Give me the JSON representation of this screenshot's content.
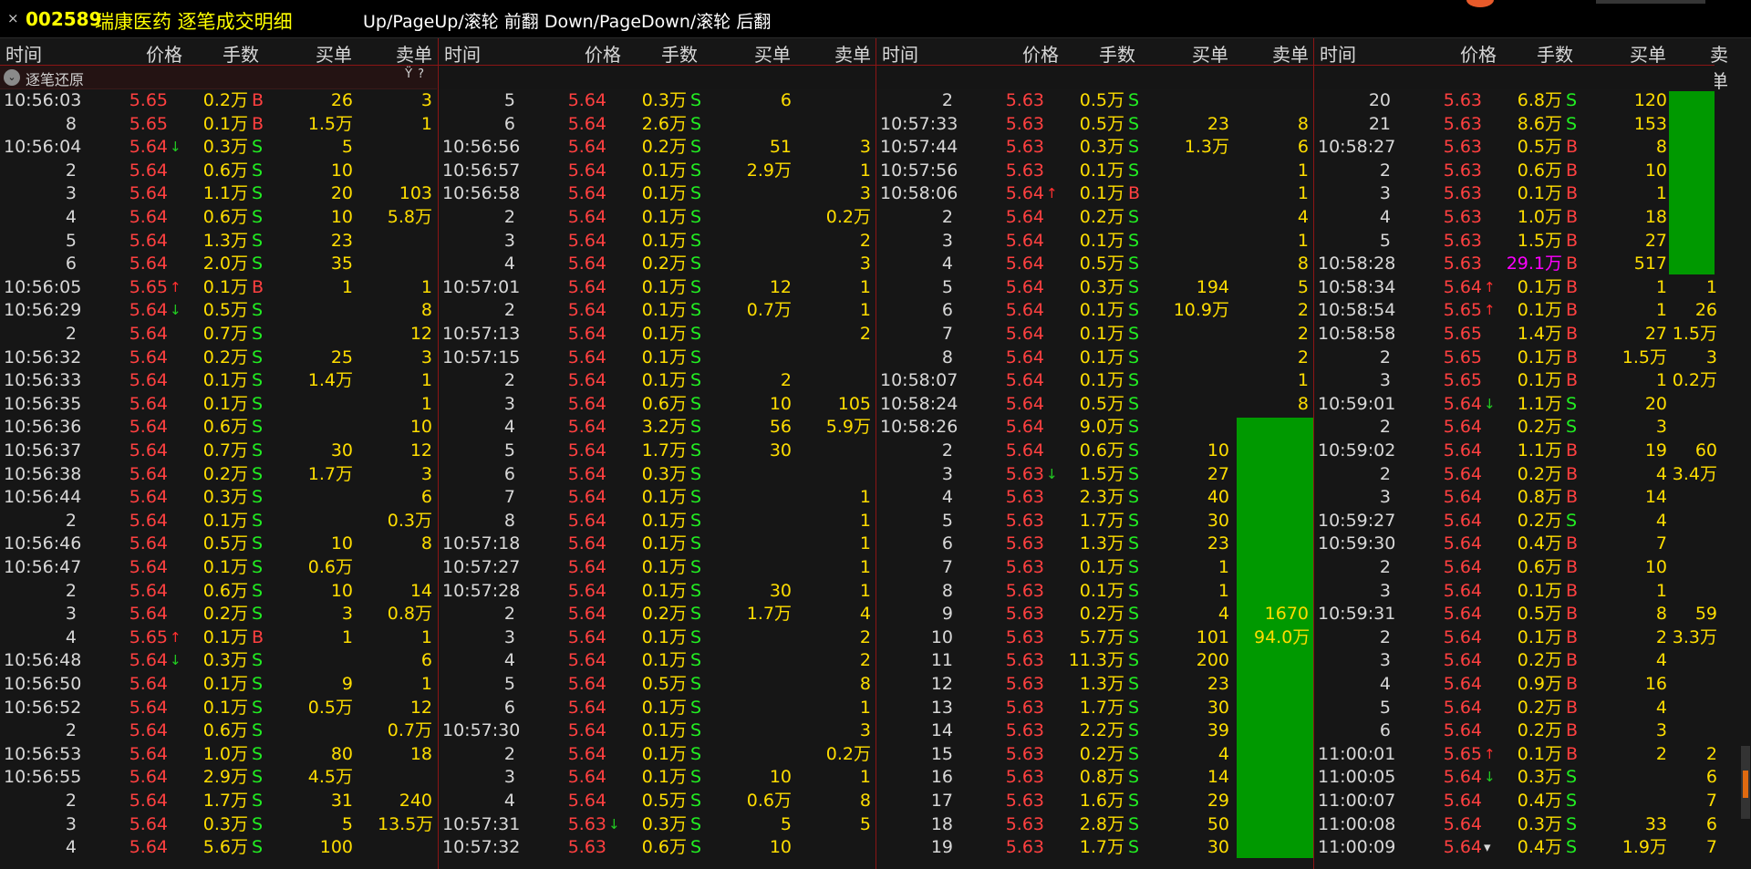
{
  "title": {
    "close": "×",
    "code": "002589",
    "name": "瑞康医药 逐笔成交明细",
    "hint": "Up/PageUp/滚轮 前翻 Down/PageDown/滚轮 后翻"
  },
  "headers": {
    "time": "时间",
    "price": "价格",
    "vol": "手数",
    "buy": "买单",
    "sell": "卖单"
  },
  "restore": {
    "label": "逐笔还原",
    "filter_icon": "Ÿ",
    "help_icon": "?"
  },
  "panels": [
    {
      "rows": [
        [
          "10:56:03",
          "5.65",
          "",
          "0.2万",
          "B",
          "26",
          "3"
        ],
        [
          "8",
          "5.65",
          "",
          "0.1万",
          "B",
          "1.5万",
          "1"
        ],
        [
          "10:56:04",
          "5.64",
          "↓",
          "0.3万",
          "S",
          "5",
          ""
        ],
        [
          "2",
          "5.64",
          "",
          "0.6万",
          "S",
          "10",
          ""
        ],
        [
          "3",
          "5.64",
          "",
          "1.1万",
          "S",
          "20",
          "103"
        ],
        [
          "4",
          "5.64",
          "",
          "0.6万",
          "S",
          "10",
          "5.8万"
        ],
        [
          "5",
          "5.64",
          "",
          "1.3万",
          "S",
          "23",
          ""
        ],
        [
          "6",
          "5.64",
          "",
          "2.0万",
          "S",
          "35",
          ""
        ],
        [
          "10:56:05",
          "5.65",
          "↑",
          "0.1万",
          "B",
          "1",
          "1"
        ],
        [
          "10:56:29",
          "5.64",
          "↓",
          "0.5万",
          "S",
          "",
          "8"
        ],
        [
          "2",
          "5.64",
          "",
          "0.7万",
          "S",
          "",
          "12"
        ],
        [
          "10:56:32",
          "5.64",
          "",
          "0.2万",
          "S",
          "25",
          "3"
        ],
        [
          "10:56:33",
          "5.64",
          "",
          "0.1万",
          "S",
          "1.4万",
          "1"
        ],
        [
          "10:56:35",
          "5.64",
          "",
          "0.1万",
          "S",
          "",
          "1"
        ],
        [
          "10:56:36",
          "5.64",
          "",
          "0.6万",
          "S",
          "",
          "10"
        ],
        [
          "10:56:37",
          "5.64",
          "",
          "0.7万",
          "S",
          "30",
          "12"
        ],
        [
          "10:56:38",
          "5.64",
          "",
          "0.2万",
          "S",
          "1.7万",
          "3"
        ],
        [
          "10:56:44",
          "5.64",
          "",
          "0.3万",
          "S",
          "",
          "6"
        ],
        [
          "2",
          "5.64",
          "",
          "0.1万",
          "S",
          "",
          "0.3万"
        ],
        [
          "10:56:46",
          "5.64",
          "",
          "0.5万",
          "S",
          "10",
          "8"
        ],
        [
          "10:56:47",
          "5.64",
          "",
          "0.1万",
          "S",
          "0.6万",
          ""
        ],
        [
          "2",
          "5.64",
          "",
          "0.6万",
          "S",
          "10",
          "14"
        ],
        [
          "3",
          "5.64",
          "",
          "0.2万",
          "S",
          "3",
          "0.8万"
        ],
        [
          "4",
          "5.65",
          "↑",
          "0.1万",
          "B",
          "1",
          "1"
        ],
        [
          "10:56:48",
          "5.64",
          "↓",
          "0.3万",
          "S",
          "",
          "6"
        ],
        [
          "10:56:50",
          "5.64",
          "",
          "0.1万",
          "S",
          "9",
          "1"
        ],
        [
          "10:56:52",
          "5.64",
          "",
          "0.1万",
          "S",
          "0.5万",
          "12"
        ],
        [
          "2",
          "5.64",
          "",
          "0.6万",
          "S",
          "",
          "0.7万"
        ],
        [
          "10:56:53",
          "5.64",
          "",
          "1.0万",
          "S",
          "80",
          "18"
        ],
        [
          "10:56:55",
          "5.64",
          "",
          "2.9万",
          "S",
          "4.5万",
          ""
        ],
        [
          "2",
          "5.64",
          "",
          "1.7万",
          "S",
          "31",
          "240"
        ],
        [
          "3",
          "5.64",
          "",
          "0.3万",
          "S",
          "5",
          "13.5万"
        ],
        [
          "4",
          "5.64",
          "",
          "5.6万",
          "S",
          "100",
          ""
        ]
      ]
    },
    {
      "rows": [
        [
          "5",
          "5.64",
          "",
          "0.3万",
          "S",
          "6",
          ""
        ],
        [
          "6",
          "5.64",
          "",
          "2.6万",
          "S",
          "",
          ""
        ],
        [
          "10:56:56",
          "5.64",
          "",
          "0.2万",
          "S",
          "51",
          "3"
        ],
        [
          "10:56:57",
          "5.64",
          "",
          "0.1万",
          "S",
          "2.9万",
          "1"
        ],
        [
          "10:56:58",
          "5.64",
          "",
          "0.1万",
          "S",
          "",
          "3"
        ],
        [
          "2",
          "5.64",
          "",
          "0.1万",
          "S",
          "",
          "0.2万"
        ],
        [
          "3",
          "5.64",
          "",
          "0.1万",
          "S",
          "",
          "2"
        ],
        [
          "4",
          "5.64",
          "",
          "0.2万",
          "S",
          "",
          "3"
        ],
        [
          "10:57:01",
          "5.64",
          "",
          "0.1万",
          "S",
          "12",
          "1"
        ],
        [
          "2",
          "5.64",
          "",
          "0.1万",
          "S",
          "0.7万",
          "1"
        ],
        [
          "10:57:13",
          "5.64",
          "",
          "0.1万",
          "S",
          "",
          "2"
        ],
        [
          "10:57:15",
          "5.64",
          "",
          "0.1万",
          "S",
          "",
          ""
        ],
        [
          "2",
          "5.64",
          "",
          "0.1万",
          "S",
          "2",
          ""
        ],
        [
          "3",
          "5.64",
          "",
          "0.6万",
          "S",
          "10",
          "105"
        ],
        [
          "4",
          "5.64",
          "",
          "3.2万",
          "S",
          "56",
          "5.9万"
        ],
        [
          "5",
          "5.64",
          "",
          "1.7万",
          "S",
          "30",
          ""
        ],
        [
          "6",
          "5.64",
          "",
          "0.3万",
          "S",
          "",
          ""
        ],
        [
          "7",
          "5.64",
          "",
          "0.1万",
          "S",
          "",
          "1"
        ],
        [
          "8",
          "5.64",
          "",
          "0.1万",
          "S",
          "",
          "1"
        ],
        [
          "10:57:18",
          "5.64",
          "",
          "0.1万",
          "S",
          "",
          "1"
        ],
        [
          "10:57:27",
          "5.64",
          "",
          "0.1万",
          "S",
          "",
          "1"
        ],
        [
          "10:57:28",
          "5.64",
          "",
          "0.1万",
          "S",
          "30",
          "1"
        ],
        [
          "2",
          "5.64",
          "",
          "0.2万",
          "S",
          "1.7万",
          "4"
        ],
        [
          "3",
          "5.64",
          "",
          "0.1万",
          "S",
          "",
          "2"
        ],
        [
          "4",
          "5.64",
          "",
          "0.1万",
          "S",
          "",
          "2"
        ],
        [
          "5",
          "5.64",
          "",
          "0.5万",
          "S",
          "",
          "8"
        ],
        [
          "6",
          "5.64",
          "",
          "0.1万",
          "S",
          "",
          "1"
        ],
        [
          "10:57:30",
          "5.64",
          "",
          "0.1万",
          "S",
          "",
          "3"
        ],
        [
          "2",
          "5.64",
          "",
          "0.1万",
          "S",
          "",
          "0.2万"
        ],
        [
          "3",
          "5.64",
          "",
          "0.1万",
          "S",
          "10",
          "1"
        ],
        [
          "4",
          "5.64",
          "",
          "0.5万",
          "S",
          "0.6万",
          "8"
        ],
        [
          "10:57:31",
          "5.63",
          "↓",
          "0.3万",
          "S",
          "5",
          "5"
        ],
        [
          "10:57:32",
          "5.63",
          "",
          "0.6万",
          "S",
          "10",
          ""
        ]
      ]
    },
    {
      "rows": [
        [
          "2",
          "5.63",
          "",
          "0.5万",
          "S",
          "",
          ""
        ],
        [
          "10:57:33",
          "5.63",
          "",
          "0.5万",
          "S",
          "23",
          "8"
        ],
        [
          "10:57:44",
          "5.63",
          "",
          "0.3万",
          "S",
          "1.3万",
          "6"
        ],
        [
          "10:57:56",
          "5.63",
          "",
          "0.1万",
          "S",
          "",
          "1"
        ],
        [
          "10:58:06",
          "5.64",
          "↑",
          "0.1万",
          "B",
          "",
          "1"
        ],
        [
          "2",
          "5.64",
          "",
          "0.2万",
          "S",
          "",
          "4"
        ],
        [
          "3",
          "5.64",
          "",
          "0.1万",
          "S",
          "",
          "1"
        ],
        [
          "4",
          "5.64",
          "",
          "0.5万",
          "S",
          "",
          "8"
        ],
        [
          "5",
          "5.64",
          "",
          "0.3万",
          "S",
          "194",
          "5"
        ],
        [
          "6",
          "5.64",
          "",
          "0.1万",
          "S",
          "10.9万",
          "2"
        ],
        [
          "7",
          "5.64",
          "",
          "0.1万",
          "S",
          "",
          "2"
        ],
        [
          "8",
          "5.64",
          "",
          "0.1万",
          "S",
          "",
          "2"
        ],
        [
          "10:58:07",
          "5.64",
          "",
          "0.1万",
          "S",
          "",
          "1"
        ],
        [
          "10:58:24",
          "5.64",
          "",
          "0.5万",
          "S",
          "",
          "8"
        ],
        [
          "10:58:26",
          "5.64",
          "",
          "9.0万",
          "S",
          "",
          ""
        ],
        [
          "2",
          "5.64",
          "",
          "0.6万",
          "S",
          "10",
          ""
        ],
        [
          "3",
          "5.63",
          "↓",
          "1.5万",
          "S",
          "27",
          ""
        ],
        [
          "4",
          "5.63",
          "",
          "2.3万",
          "S",
          "40",
          ""
        ],
        [
          "5",
          "5.63",
          "",
          "1.7万",
          "S",
          "30",
          ""
        ],
        [
          "6",
          "5.63",
          "",
          "1.3万",
          "S",
          "23",
          ""
        ],
        [
          "7",
          "5.63",
          "",
          "0.1万",
          "S",
          "1",
          ""
        ],
        [
          "8",
          "5.63",
          "",
          "0.1万",
          "S",
          "1",
          ""
        ],
        [
          "9",
          "5.63",
          "",
          "0.2万",
          "S",
          "4",
          "1670"
        ],
        [
          "10",
          "5.63",
          "",
          "5.7万",
          "S",
          "101",
          "94.0万"
        ],
        [
          "11",
          "5.63",
          "",
          "11.3万",
          "S",
          "200",
          ""
        ],
        [
          "12",
          "5.63",
          "",
          "1.3万",
          "S",
          "23",
          ""
        ],
        [
          "13",
          "5.63",
          "",
          "1.7万",
          "S",
          "30",
          ""
        ],
        [
          "14",
          "5.63",
          "",
          "2.2万",
          "S",
          "39",
          ""
        ],
        [
          "15",
          "5.63",
          "",
          "0.2万",
          "S",
          "4",
          ""
        ],
        [
          "16",
          "5.63",
          "",
          "0.8万",
          "S",
          "14",
          ""
        ],
        [
          "17",
          "5.63",
          "",
          "1.6万",
          "S",
          "29",
          ""
        ],
        [
          "18",
          "5.63",
          "",
          "2.8万",
          "S",
          "50",
          ""
        ],
        [
          "19",
          "5.63",
          "",
          "1.7万",
          "S",
          "30",
          ""
        ]
      ]
    },
    {
      "rows": [
        [
          "20",
          "5.63",
          "",
          "6.8万",
          "S",
          "120",
          ""
        ],
        [
          "21",
          "5.63",
          "",
          "8.6万",
          "S",
          "153",
          ""
        ],
        [
          "10:58:27",
          "5.63",
          "",
          "0.5万",
          "B",
          "8",
          ""
        ],
        [
          "2",
          "5.63",
          "",
          "0.6万",
          "B",
          "10",
          ""
        ],
        [
          "3",
          "5.63",
          "",
          "0.1万",
          "B",
          "1",
          ""
        ],
        [
          "4",
          "5.63",
          "",
          "1.0万",
          "B",
          "18",
          ""
        ],
        [
          "5",
          "5.63",
          "",
          "1.5万",
          "B",
          "27",
          ""
        ],
        [
          "10:58:28",
          "5.63",
          "",
          "29.1万",
          "B",
          "517",
          ""
        ],
        [
          "10:58:34",
          "5.64",
          "↑",
          "0.1万",
          "B",
          "1",
          "1"
        ],
        [
          "10:58:54",
          "5.65",
          "↑",
          "0.1万",
          "B",
          "1",
          "26"
        ],
        [
          "10:58:58",
          "5.65",
          "",
          "1.4万",
          "B",
          "27",
          "1.5万"
        ],
        [
          "2",
          "5.65",
          "",
          "0.1万",
          "B",
          "1.5万",
          "3"
        ],
        [
          "3",
          "5.65",
          "",
          "0.1万",
          "B",
          "1",
          "0.2万"
        ],
        [
          "10:59:01",
          "5.64",
          "↓",
          "1.1万",
          "S",
          "20",
          ""
        ],
        [
          "2",
          "5.64",
          "",
          "0.2万",
          "S",
          "3",
          ""
        ],
        [
          "10:59:02",
          "5.64",
          "",
          "1.1万",
          "B",
          "19",
          "60"
        ],
        [
          "2",
          "5.64",
          "",
          "0.2万",
          "B",
          "4",
          "3.4万"
        ],
        [
          "3",
          "5.64",
          "",
          "0.8万",
          "B",
          "14",
          ""
        ],
        [
          "10:59:27",
          "5.64",
          "",
          "0.2万",
          "S",
          "4",
          ""
        ],
        [
          "10:59:30",
          "5.64",
          "",
          "0.4万",
          "B",
          "7",
          ""
        ],
        [
          "2",
          "5.64",
          "",
          "0.6万",
          "B",
          "10",
          ""
        ],
        [
          "3",
          "5.64",
          "",
          "0.1万",
          "B",
          "1",
          ""
        ],
        [
          "10:59:31",
          "5.64",
          "",
          "0.5万",
          "B",
          "8",
          "59"
        ],
        [
          "2",
          "5.64",
          "",
          "0.1万",
          "B",
          "2",
          "3.3万"
        ],
        [
          "3",
          "5.64",
          "",
          "0.2万",
          "B",
          "4",
          ""
        ],
        [
          "4",
          "5.64",
          "",
          "0.9万",
          "B",
          "16",
          ""
        ],
        [
          "5",
          "5.64",
          "",
          "0.2万",
          "B",
          "4",
          ""
        ],
        [
          "6",
          "5.64",
          "",
          "0.2万",
          "B",
          "3",
          ""
        ],
        [
          "11:00:01",
          "5.65",
          "↑",
          "0.1万",
          "B",
          "2",
          "2"
        ],
        [
          "11:00:05",
          "5.64",
          "↓",
          "0.3万",
          "S",
          "",
          "6"
        ],
        [
          "11:00:07",
          "5.64",
          "",
          "0.4万",
          "S",
          "",
          "7"
        ],
        [
          "11:00:08",
          "5.64",
          "",
          "0.3万",
          "S",
          "33",
          "6"
        ],
        [
          "11:00:09",
          "5.64",
          "▾",
          "0.4万",
          "S",
          "1.9万",
          "7"
        ]
      ]
    }
  ],
  "colors": {
    "bg": "#161616",
    "price": "#ff4040",
    "vol": "#ffdd00",
    "buy_flag": "#ff4040",
    "sell_flag": "#22ee22",
    "frame": "#8b1515",
    "big_order": "#009900"
  }
}
